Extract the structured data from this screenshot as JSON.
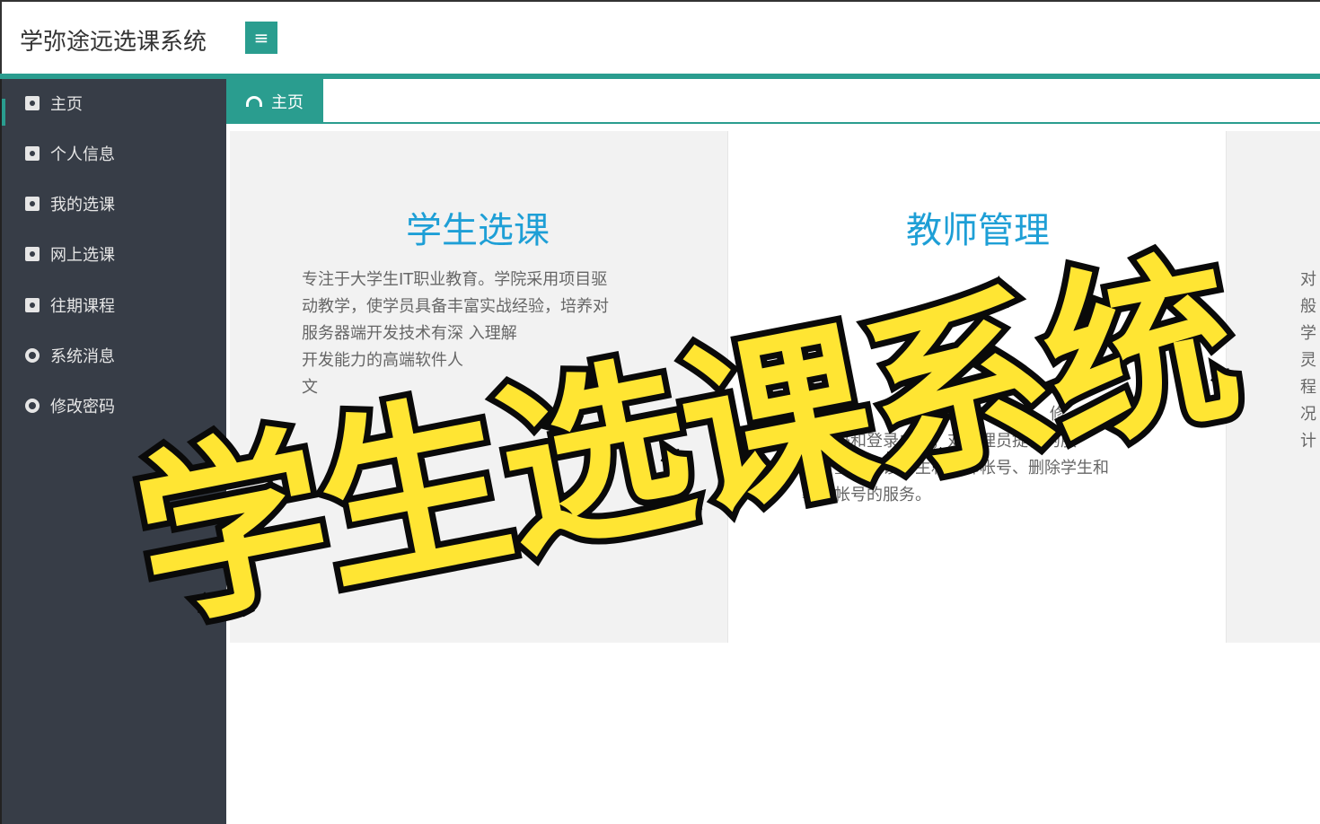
{
  "header": {
    "app_title": "学弥途远选课系统",
    "menu_toggle_icon": "≡"
  },
  "colors": {
    "accent": "#2a9d8f",
    "sidebar_bg": "#373d47",
    "heading_blue": "#1e9fd6",
    "overlay_yellow": "#ffe533"
  },
  "sidebar": {
    "items": [
      {
        "label": "主页",
        "icon": "id-card-icon"
      },
      {
        "label": "个人信息",
        "icon": "id-card-icon"
      },
      {
        "label": "我的选课",
        "icon": "id-card-icon"
      },
      {
        "label": "网上选课",
        "icon": "id-card-icon"
      },
      {
        "label": "往期课程",
        "icon": "id-card-icon"
      },
      {
        "label": "系统消息",
        "icon": "circle-icon"
      },
      {
        "label": "修改密码",
        "icon": "circle-icon"
      }
    ]
  },
  "tabs": {
    "home_label": "主页",
    "home_icon": "dashboard-icon"
  },
  "panels": [
    {
      "title": "学生选课",
      "lines": [
        "专注于大学生IT职业教育。学院采用项目驱",
        "动教学，使学员具备丰富实战经验，培养对",
        "服务器端开发技术有深 入理解",
        "开发能力的高端软件人",
        "文"
      ]
    },
    {
      "title": "教师管理",
      "lines": [
        "提供的服务有登录、修",
        "改密码和登录成绩；对管理员提供的服",
        "务有登录开设学生和教师帐号、删除学生和",
        "教师帐号的服务。"
      ]
    },
    {
      "title": "",
      "lines": [
        "对",
        "般",
        "学",
        "灵",
        "程",
        "况",
        "计"
      ]
    }
  ],
  "overlay": {
    "text": "学生选课系统"
  }
}
